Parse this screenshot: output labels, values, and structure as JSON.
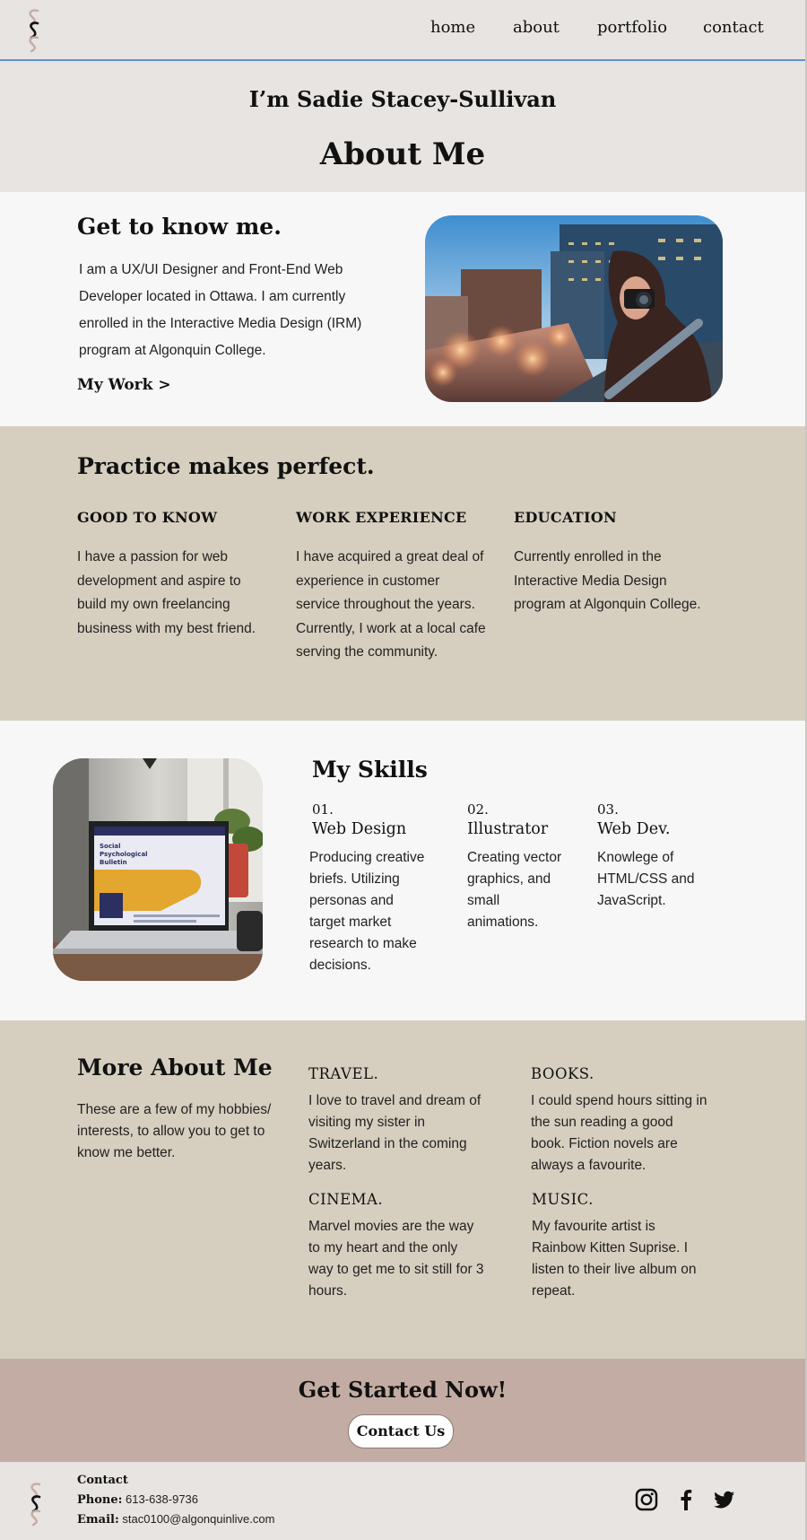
{
  "nav": {
    "links": [
      "home",
      "about",
      "portfolio",
      "contact"
    ]
  },
  "hero": {
    "subtitle": "I’m Sadie Stacey-Sullivan",
    "title": "About Me"
  },
  "know": {
    "title": "Get to know me.",
    "lines": [
      "I am a UX/UI Designer and Front-End Web",
      "Developer located in Ottawa.  I am currently",
      "enrolled in the Interactive Media Design (IRM)",
      "program at Algonquin College."
    ],
    "link": "My Work >"
  },
  "practice": {
    "title": "Practice makes perfect.",
    "columns": [
      {
        "heading": "GOOD TO KNOW",
        "lines": [
          "I have a passion for web",
          "development and aspire to",
          "build my own freelancing",
          "business with my best friend."
        ]
      },
      {
        "heading": "WORK EXPERIENCE",
        "lines": [
          "I have acquired a great deal of",
          "experience in customer",
          "service throughout the years.",
          "Currently,  I work at a local cafe",
          "serving the community."
        ]
      },
      {
        "heading": "EDUCATION",
        "lines": [
          "Currently enrolled in the",
          "Interactive Media Design",
          "program at Algonquin College."
        ]
      }
    ]
  },
  "skills": {
    "title": "My Skills",
    "items": [
      {
        "num": "01.",
        "name": "Web Design",
        "lines": [
          "Producing creative",
          "briefs. Utilizing",
          "personas and",
          "target market",
          "research to make",
          "decisions."
        ]
      },
      {
        "num": "02.",
        "name": "Illustrator",
        "lines": [
          "Creating vector",
          "graphics, and",
          "small",
          "animations."
        ]
      },
      {
        "num": "03.",
        "name": "Web Dev.",
        "lines": [
          "Knowlege of",
          "HTML/CSS and",
          "JavaScript."
        ]
      }
    ]
  },
  "more": {
    "title": "More About Me",
    "lines": [
      "These are a few of my hobbies/",
      "interests,  to allow you to get to",
      "know me better."
    ],
    "items": [
      {
        "heading": "TRAVEL.",
        "lines": [
          "I love to travel and dream of",
          "visiting my sister in",
          "Switzerland in the coming",
          "years."
        ]
      },
      {
        "heading": "BOOKS.",
        "lines": [
          "I could spend hours sitting in",
          "the sun reading a good",
          "book. Fiction novels are",
          "always a favourite."
        ]
      },
      {
        "heading": "CINEMA.",
        "lines": [
          "Marvel movies are the way",
          "to my heart and the only",
          "way to get me to sit still for 3",
          "hours."
        ]
      },
      {
        "heading": "MUSIC.",
        "lines": [
          "My favourite artist is",
          "Rainbow Kitten Suprise. I",
          "listen to their live album on",
          "repeat."
        ]
      }
    ]
  },
  "cta": {
    "title": "Get Started Now!",
    "button": "Contact Us"
  },
  "footer": {
    "contact_heading": "Contact",
    "phone_label": "Phone:",
    "phone": "613-638-9736",
    "email_label": "Email:",
    "email": "stac0100@algonquinlive.com"
  },
  "icons": {
    "social": [
      "instagram-icon",
      "facebook-icon",
      "twitter-icon"
    ],
    "logo": "s-monogram-logo"
  },
  "colors": {
    "nav_bg": "#e7e4e1",
    "nav_border": "#5b8fdc",
    "section_light": "#f7f7f7",
    "section_tan": "#d6cfbf",
    "cta_bg": "#c3aca3",
    "logo_accent": "#c3aca3"
  }
}
